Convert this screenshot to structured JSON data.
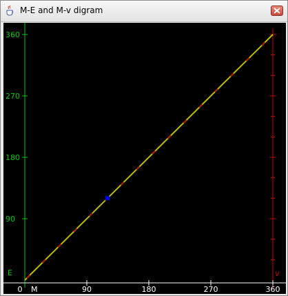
{
  "window": {
    "title": "M-E and M-v digram",
    "icon": "java-cup-icon",
    "close_icon": "close-icon"
  },
  "colors": {
    "background": "#000000",
    "e_axis": "#00c800",
    "v_axis": "#c80000",
    "m_axis": "#ffffff",
    "e_curve": "#bdbd00",
    "v_curve": "#c00000",
    "marker": "#0000ff"
  },
  "chart_data": {
    "type": "line",
    "xlabel": "M",
    "ylabel_left": "E",
    "ylabel_right": "v",
    "xlim": [
      0,
      360
    ],
    "ylim": [
      0,
      360
    ],
    "x_ticks": [
      "0",
      "90",
      "180",
      "270",
      "360"
    ],
    "y_ticks_left": [
      "90",
      "180",
      "270",
      "360"
    ],
    "grid": false,
    "series": [
      {
        "name": "E",
        "x": [
          0,
          360
        ],
        "y": [
          0,
          360
        ]
      },
      {
        "name": "v",
        "x": [
          0,
          360
        ],
        "y": [
          0,
          360
        ]
      }
    ],
    "marker": {
      "x": 120,
      "y": 120
    }
  }
}
